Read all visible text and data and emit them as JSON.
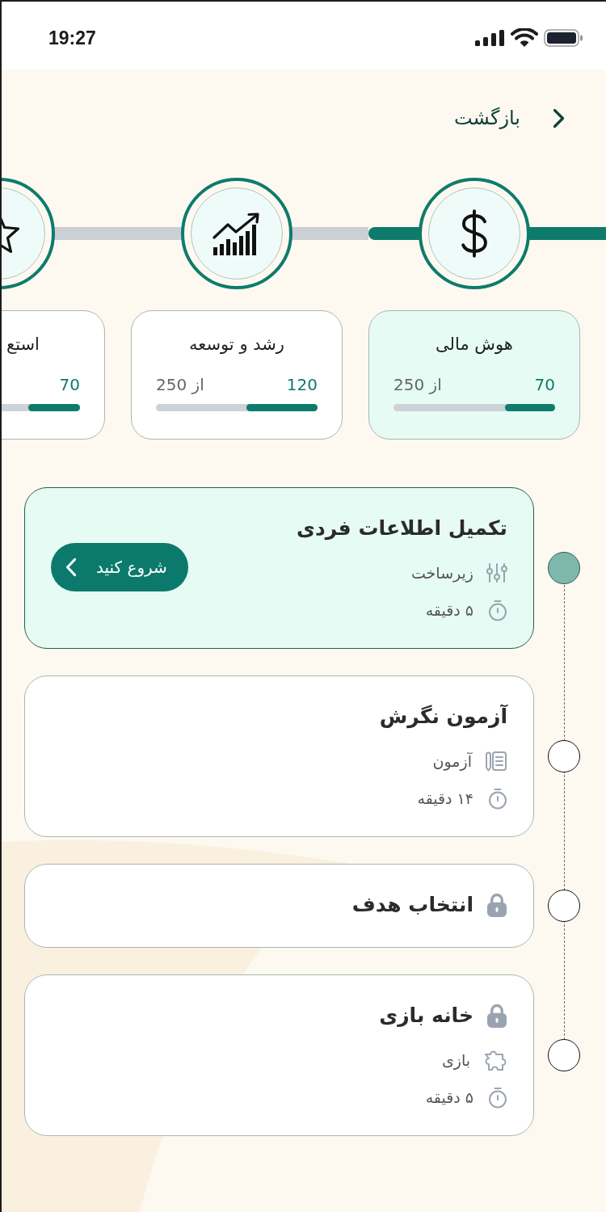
{
  "status_bar": {
    "time": "19:27"
  },
  "back_button": {
    "label": "بازگشت"
  },
  "categories": [
    {
      "title": "هوش مالی",
      "score": "70",
      "total": "از 250",
      "level": 0.31,
      "selected": true
    },
    {
      "title": "رشد و توسعه",
      "score": "120",
      "total": "از 250",
      "level": 0.44,
      "selected": false
    },
    {
      "title": "استع",
      "score": "70",
      "level": 0.32,
      "selected": false
    }
  ],
  "tasks": [
    {
      "title": "تکمیل اطلاعات فردی",
      "locked": false,
      "current": true,
      "type": "زیرساخت",
      "duration": "۵ دقیقه",
      "button": "شروع کنید"
    },
    {
      "title": "آزمون نگرش",
      "locked": false,
      "current": false,
      "type": "آزمون",
      "duration": "۱۴ دقیقه"
    },
    {
      "title": "انتخاب هدف",
      "locked": true,
      "current": false
    },
    {
      "title": "خانه بازی",
      "locked": true,
      "current": false,
      "type": "بازی",
      "duration": "۵ دقیقه"
    }
  ]
}
